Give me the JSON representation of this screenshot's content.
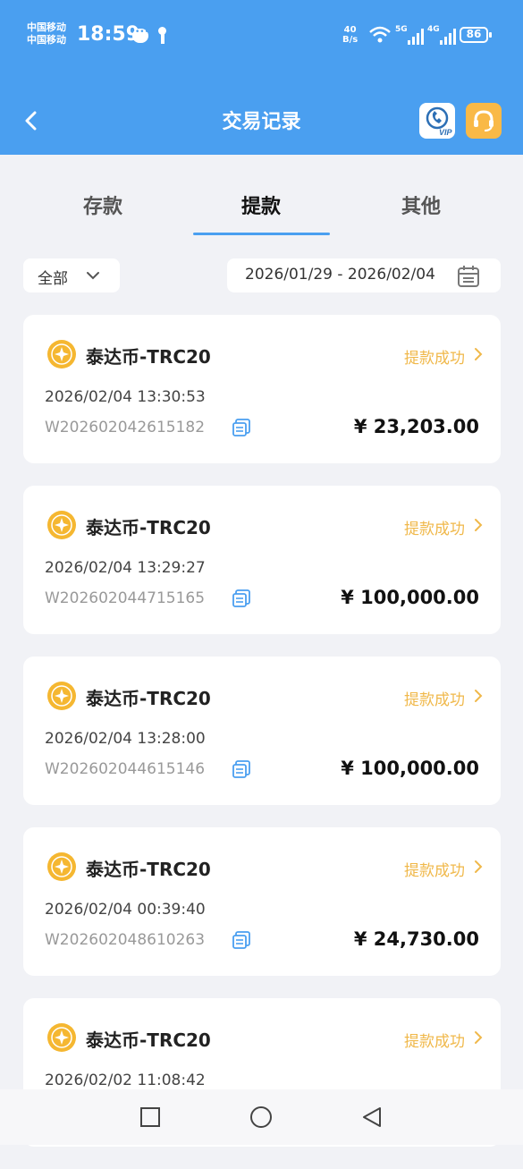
{
  "status_bar": {
    "carrier_1": "中国移动",
    "carrier_2": "中国移动",
    "time": "18:59",
    "net_speed_value": "40",
    "net_speed_unit": "B/s",
    "signal_1_label": "5G",
    "signal_2_label": "4G",
    "battery": "86"
  },
  "header": {
    "title": "交易记录",
    "vip_label": "VIP"
  },
  "tabs": [
    {
      "label": "存款"
    },
    {
      "label": "提款"
    },
    {
      "label": "其他"
    }
  ],
  "active_tab": "提款",
  "filters": {
    "type_value": "全部",
    "date_range": "2026/01/29 - 2026/02/04"
  },
  "transactions": [
    {
      "currency": "泰达币-TRC20",
      "status": "提款成功",
      "datetime": "2026/02/04 13:30:53",
      "order_id": "W202602042615182",
      "amount": "¥ 23,203.00"
    },
    {
      "currency": "泰达币-TRC20",
      "status": "提款成功",
      "datetime": "2026/02/04 13:29:27",
      "order_id": "W202602044715165",
      "amount": "¥ 100,000.00"
    },
    {
      "currency": "泰达币-TRC20",
      "status": "提款成功",
      "datetime": "2026/02/04 13:28:00",
      "order_id": "W202602044615146",
      "amount": "¥ 100,000.00"
    },
    {
      "currency": "泰达币-TRC20",
      "status": "提款成功",
      "datetime": "2026/02/04 00:39:40",
      "order_id": "W202602048610263",
      "amount": "¥ 24,730.00"
    },
    {
      "currency": "泰达币-TRC20",
      "status": "提款成功",
      "datetime": "2026/02/02 11:08:42",
      "order_id": "",
      "amount": ""
    }
  ],
  "colors": {
    "header_bg": "#4a9ff0",
    "status_text": "#f0b84a",
    "coin": "#f5b731",
    "page_bg": "#f1f2f6"
  },
  "icons": {
    "back": "chevron-left-icon",
    "vip": "vip-phone-icon",
    "service": "headset-icon",
    "filter": "chevron-down-icon",
    "calendar": "calendar-icon",
    "coin": "coin-icon",
    "copy": "copy-icon",
    "nav": [
      "square-icon",
      "circle-icon",
      "triangle-back-icon"
    ]
  }
}
